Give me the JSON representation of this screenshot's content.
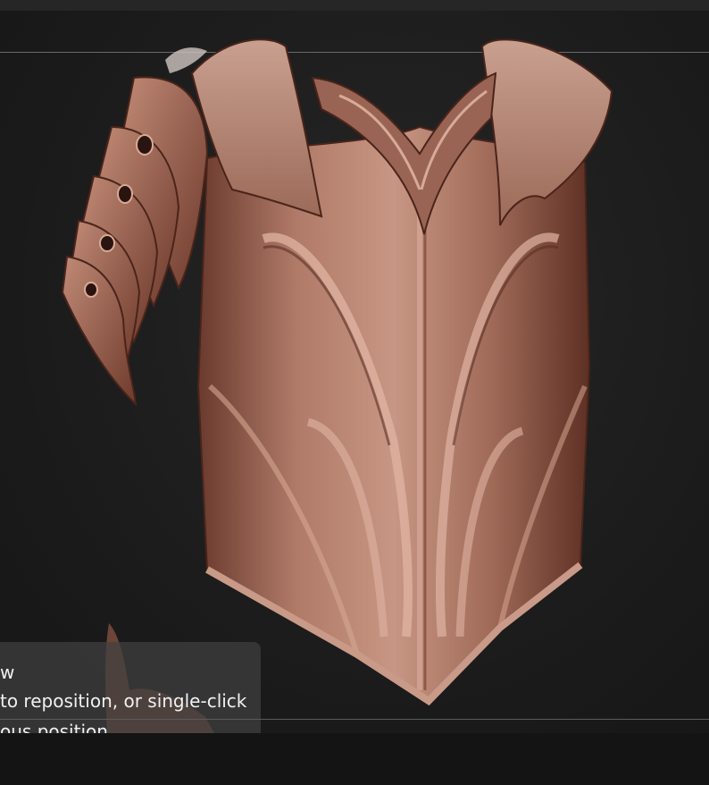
{
  "viewport": {
    "model_name": "",
    "model_colors": {
      "base": "#a8705e",
      "highlight": "#d8aa98",
      "shadow": "#5a2e24"
    }
  },
  "hint": {
    "title_fragment": "w",
    "line1": "to reposition, or single-click",
    "line2": "ous position"
  }
}
